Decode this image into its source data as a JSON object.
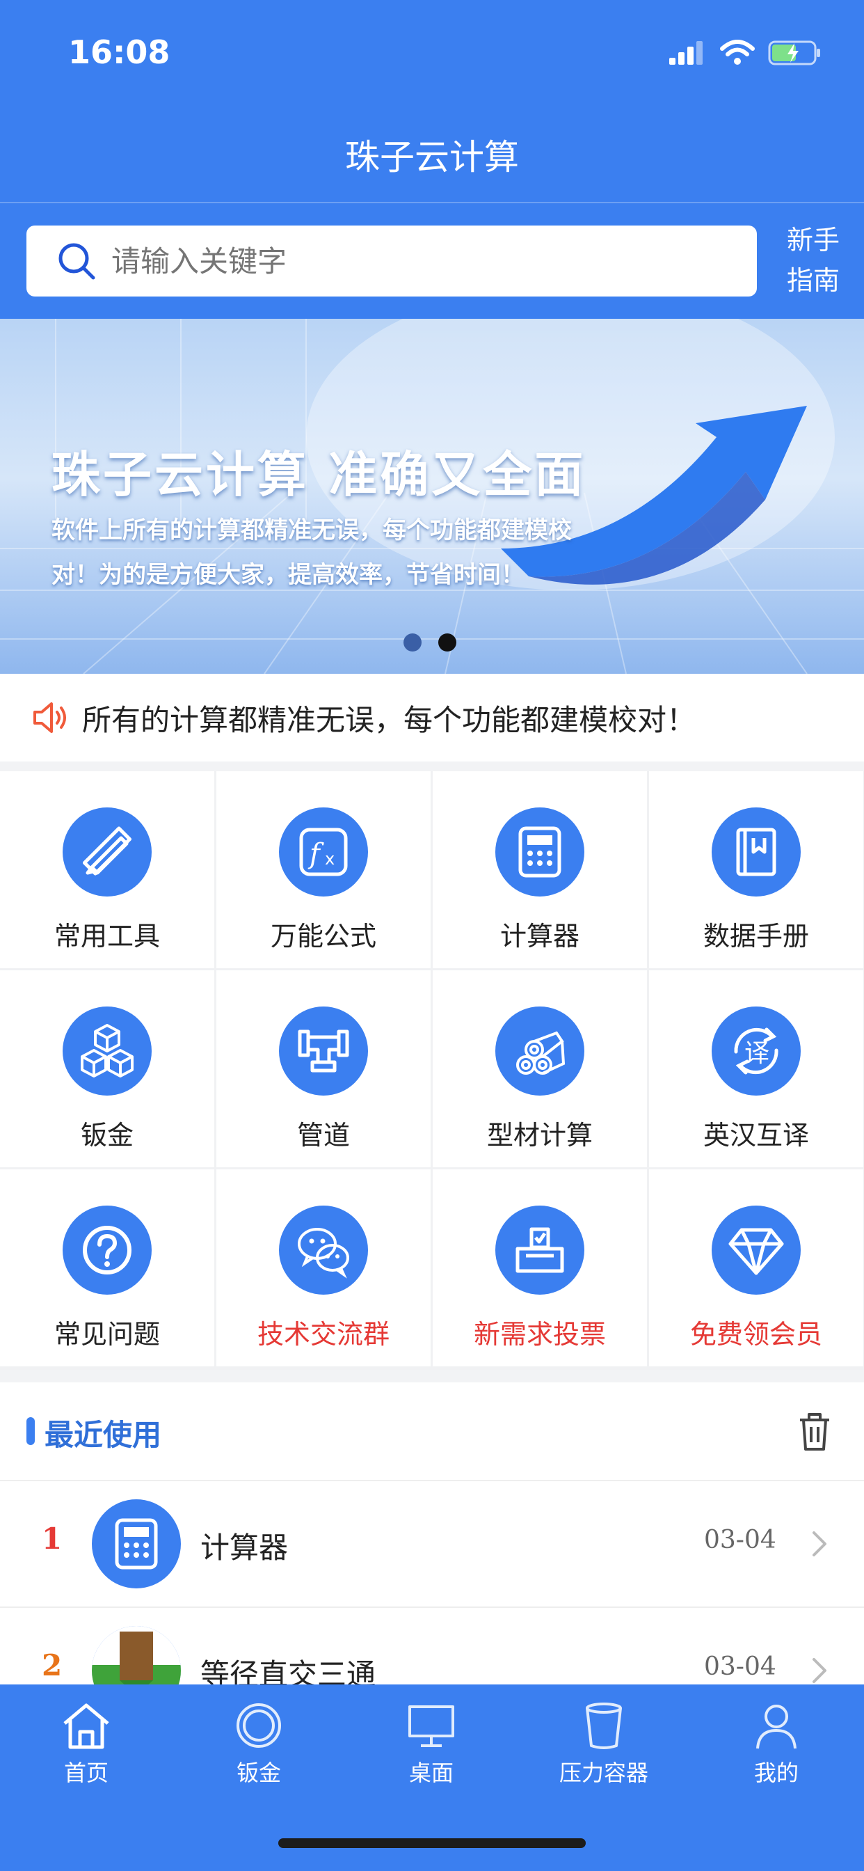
{
  "status_bar": {
    "time": "16:08"
  },
  "header": {
    "title": "珠子云计算",
    "guide_label": "新手指南"
  },
  "search": {
    "placeholder": "请输入关键字"
  },
  "banner": {
    "headline": "珠子云计算  准确又全面",
    "subtitle": "软件上所有的计算都精准无误，每个功能都建模校对！为的是方便大家，提高效率，节省时间！",
    "active_dot": 2,
    "dot_count": 2
  },
  "notice": {
    "text": "所有的计算都精准无误，每个功能都建模校对！"
  },
  "grid": {
    "items": [
      {
        "label": "常用工具",
        "icon": "ruler-pencil-icon",
        "highlight": false
      },
      {
        "label": "万能公式",
        "icon": "formula-icon",
        "highlight": false
      },
      {
        "label": "计算器",
        "icon": "calculator-icon",
        "highlight": false
      },
      {
        "label": "数据手册",
        "icon": "book-icon",
        "highlight": false
      },
      {
        "label": "钣金",
        "icon": "cubes-icon",
        "highlight": false
      },
      {
        "label": "管道",
        "icon": "pipe-icon",
        "highlight": false
      },
      {
        "label": "型材计算",
        "icon": "profile-icon",
        "highlight": false
      },
      {
        "label": "英汉互译",
        "icon": "translate-icon",
        "highlight": false
      },
      {
        "label": "常见问题",
        "icon": "question-icon",
        "highlight": false
      },
      {
        "label": "技术交流群",
        "icon": "wechat-icon",
        "highlight": true
      },
      {
        "label": "新需求投票",
        "icon": "ballot-box-icon",
        "highlight": true
      },
      {
        "label": "免费领会员",
        "icon": "diamond-icon",
        "highlight": true
      }
    ]
  },
  "recent": {
    "title": "最近使用",
    "items": [
      {
        "rank": "1",
        "name": "计算器",
        "date": "03-04",
        "icon": "calculator-icon"
      },
      {
        "rank": "2",
        "name": "等径直交三通",
        "date": "03-04",
        "icon": "tee-pipe-icon"
      }
    ]
  },
  "tabbar": {
    "items": [
      {
        "label": "首页",
        "icon": "home-icon",
        "active": true
      },
      {
        "label": "钣金",
        "icon": "ring-icon",
        "active": false
      },
      {
        "label": "桌面",
        "icon": "monitor-icon",
        "active": false
      },
      {
        "label": "压力容器",
        "icon": "cup-icon",
        "active": false
      },
      {
        "label": "我的",
        "icon": "user-icon",
        "active": false
      }
    ]
  },
  "colors": {
    "primary": "#3b7ff0",
    "highlight_text": "#e53935",
    "rank_1": "#e53935",
    "rank_2": "#e8741a"
  }
}
